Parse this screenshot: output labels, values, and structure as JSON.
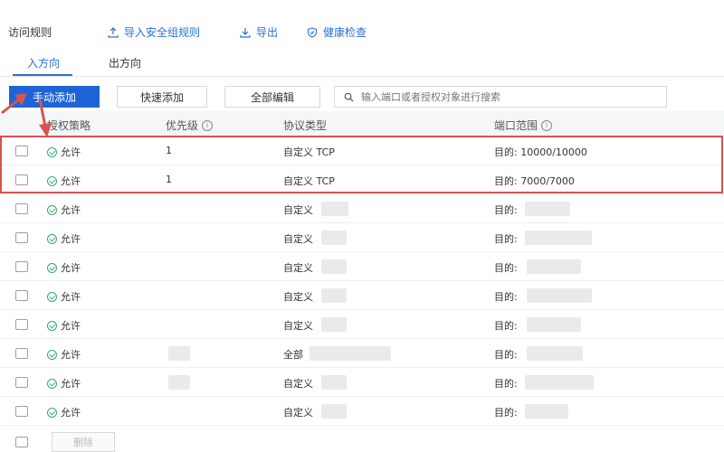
{
  "header": {
    "title": "访问规则",
    "links": [
      {
        "label": "导入安全组规则",
        "icon": "upload-icon"
      },
      {
        "label": "导出",
        "icon": "download-icon"
      },
      {
        "label": "健康检查",
        "icon": "shield-check-icon"
      }
    ]
  },
  "tabs": [
    {
      "label": "入方向",
      "active": true
    },
    {
      "label": "出方向",
      "active": false
    }
  ],
  "toolbar": {
    "manual_add": "手动添加",
    "quick_add": "快速添加",
    "edit_all": "全部编辑",
    "search_placeholder": "输入端口或者授权对象进行搜索"
  },
  "table": {
    "columns": [
      "授权策略",
      "优先级",
      "协议类型",
      "端口范围"
    ],
    "rows": [
      {
        "policy": "允许",
        "priority": "1",
        "protocol": "自定义 TCP",
        "port": "目的: 10000/10000"
      },
      {
        "policy": "允许",
        "priority": "1",
        "protocol": "自定义 TCP",
        "port": "目的: 7000/7000"
      },
      {
        "policy": "允许",
        "priority": "",
        "protocol": "自定义",
        "port": "目的:"
      },
      {
        "policy": "允许",
        "priority": "",
        "protocol": "自定义",
        "port": "目的:"
      },
      {
        "policy": "允许",
        "priority": "",
        "protocol": "自定义",
        "port": "目的:"
      },
      {
        "policy": "允许",
        "priority": "",
        "protocol": "自定义",
        "port": "目的:"
      },
      {
        "policy": "允许",
        "priority": "",
        "protocol": "自定义",
        "port": "目的:"
      },
      {
        "policy": "允许",
        "priority": "",
        "protocol": "全部",
        "port": "目的:"
      },
      {
        "policy": "允许",
        "priority": "",
        "protocol": "自定义",
        "port": "目的:"
      },
      {
        "policy": "允许",
        "priority": "",
        "protocol": "自定义",
        "port": "目的:"
      }
    ]
  },
  "footer": {
    "delete_label": "删除"
  },
  "colors": {
    "accent": "#1f64d6",
    "highlight": "#d9534f",
    "allow": "#39a96b"
  }
}
